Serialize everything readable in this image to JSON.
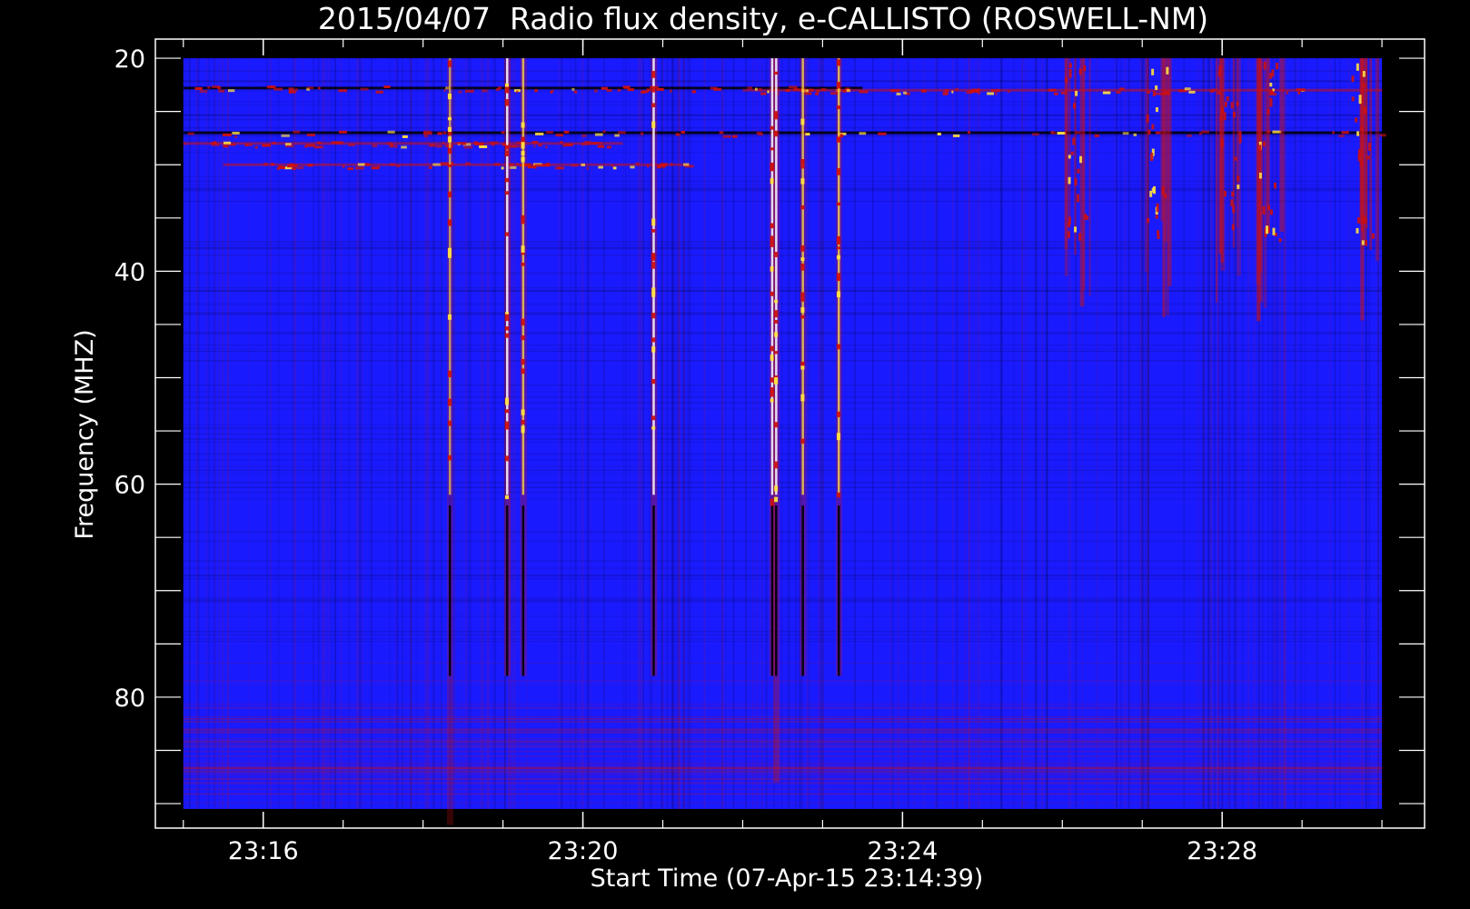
{
  "chart_data": {
    "type": "heatmap",
    "title": "2015/04/07  Radio flux density, e-CALLISTO (ROSWELL-NM)",
    "xlabel": "Start Time (07-Apr-15 23:14:39)",
    "ylabel": "Frequency (MHZ)",
    "y_inverted": true,
    "xlim_minutes": [
      "23:14:39",
      "23:30:32"
    ],
    "data_time_range": [
      "23:15:00",
      "23:30:00"
    ],
    "ylim": [
      18.2,
      92.3
    ],
    "data_frequency_range": [
      20,
      90.5
    ],
    "x_ticks": [
      "23:16",
      "23:20",
      "23:24",
      "23:28"
    ],
    "x_minor_tick_step_minutes": 1,
    "y_ticks": [
      20,
      40,
      60,
      80
    ],
    "y_minor_tick_step": 5,
    "grid": false,
    "colormap": "blue-red-yellow-white",
    "colors": {
      "background": "#000000",
      "baseline": "#1a1aff",
      "low": "#000000",
      "medium": "#cc1010",
      "high": "#ffe040",
      "peak": "#ffffff"
    },
    "broadband_bursts": [
      {
        "time": "23:18:20",
        "freq_range": [
          20,
          92
        ],
        "intensity": 0.75
      },
      {
        "time": "23:19:03",
        "freq_range": [
          20,
          78
        ],
        "intensity": 1.0
      },
      {
        "time": "23:19:15",
        "freq_range": [
          20,
          78
        ],
        "intensity": 0.9
      },
      {
        "time": "23:20:53",
        "freq_range": [
          20,
          78
        ],
        "intensity": 1.0
      },
      {
        "time": "23:22:22",
        "freq_range": [
          20,
          78
        ],
        "intensity": 1.0
      },
      {
        "time": "23:22:25",
        "freq_range": [
          20,
          88
        ],
        "intensity": 1.0
      },
      {
        "time": "23:22:45",
        "freq_range": [
          20,
          78
        ],
        "intensity": 0.9
      },
      {
        "time": "23:23:12",
        "freq_range": [
          20,
          78
        ],
        "intensity": 0.9
      }
    ],
    "narrowband_bursts": [
      {
        "time": "23:26:10",
        "freq_range": [
          20,
          45
        ],
        "intensity": 0.7
      },
      {
        "time": "23:27:10",
        "freq_range": [
          20,
          45
        ],
        "intensity": 0.75
      },
      {
        "time": "23:28:05",
        "freq_range": [
          20,
          45
        ],
        "intensity": 0.8
      },
      {
        "time": "23:28:35",
        "freq_range": [
          20,
          45
        ],
        "intensity": 0.8
      },
      {
        "time": "23:29:45",
        "freq_range": [
          20,
          45
        ],
        "intensity": 0.75
      }
    ],
    "interference_lines": [
      {
        "freq": 22.8,
        "time_range": [
          "23:15:00",
          "23:23:30"
        ],
        "level": "low"
      },
      {
        "freq": 27.0,
        "time_range": [
          "23:15:00",
          "23:30:00"
        ],
        "level": "low"
      },
      {
        "freq": 28.0,
        "time_range": [
          "23:15:00",
          "23:20:30"
        ],
        "level": "medium"
      },
      {
        "freq": 30.0,
        "time_range": [
          "23:15:30",
          "23:21:20"
        ],
        "level": "medium"
      },
      {
        "freq": 23.0,
        "time_range": [
          "23:22:00",
          "23:30:00"
        ],
        "level": "medium"
      }
    ]
  }
}
